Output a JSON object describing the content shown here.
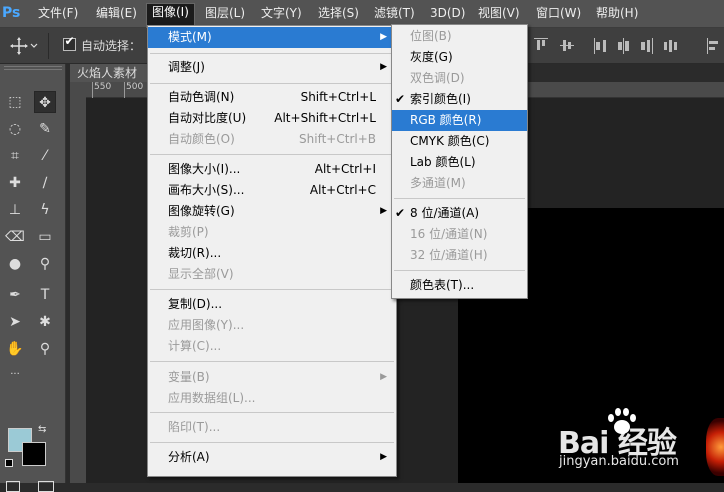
{
  "app": {
    "logo": "Ps"
  },
  "menubar": [
    {
      "label": "文件(F)"
    },
    {
      "label": "编辑(E)"
    },
    {
      "label": "图像(I)",
      "active": true
    },
    {
      "label": "图层(L)"
    },
    {
      "label": "文字(Y)"
    },
    {
      "label": "选择(S)"
    },
    {
      "label": "滤镜(T)"
    },
    {
      "label": "3D(D)"
    },
    {
      "label": "视图(V)"
    },
    {
      "label": "窗口(W)"
    },
    {
      "label": "帮助(H)"
    }
  ],
  "options": {
    "auto_select_label": "自动选择：",
    "auto_select_checked": true,
    "move_tool_icon": "move-icon"
  },
  "document": {
    "tab_title": "火焰人素材",
    "ruler_ticks": [
      "550",
      "500"
    ]
  },
  "image_menu": {
    "items": [
      {
        "label": "模式(M)",
        "shortcut": "",
        "submenu": true,
        "disabled": false,
        "highlighted": true
      },
      {
        "label": "调整(J)",
        "shortcut": "",
        "submenu": true,
        "disabled": false
      },
      {
        "label": "自动色调(N)",
        "shortcut": "Shift+Ctrl+L",
        "disabled": false
      },
      {
        "label": "自动对比度(U)",
        "shortcut": "Alt+Shift+Ctrl+L",
        "disabled": false
      },
      {
        "label": "自动颜色(O)",
        "shortcut": "Shift+Ctrl+B",
        "disabled": true
      },
      {
        "label": "图像大小(I)...",
        "shortcut": "Alt+Ctrl+I",
        "disabled": false
      },
      {
        "label": "画布大小(S)...",
        "shortcut": "Alt+Ctrl+C",
        "disabled": false
      },
      {
        "label": "图像旋转(G)",
        "shortcut": "",
        "submenu": true,
        "disabled": false
      },
      {
        "label": "裁剪(P)",
        "shortcut": "",
        "disabled": true
      },
      {
        "label": "裁切(R)...",
        "shortcut": "",
        "disabled": false
      },
      {
        "label": "显示全部(V)",
        "shortcut": "",
        "disabled": true
      },
      {
        "label": "复制(D)...",
        "shortcut": "",
        "disabled": false
      },
      {
        "label": "应用图像(Y)...",
        "shortcut": "",
        "disabled": true
      },
      {
        "label": "计算(C)...",
        "shortcut": "",
        "disabled": true
      },
      {
        "label": "变量(B)",
        "shortcut": "",
        "submenu": true,
        "disabled": true
      },
      {
        "label": "应用数据组(L)...",
        "shortcut": "",
        "disabled": true
      },
      {
        "label": "陷印(T)...",
        "shortcut": "",
        "disabled": true
      },
      {
        "label": "分析(A)",
        "shortcut": "",
        "submenu": true,
        "disabled": false
      }
    ]
  },
  "mode_submenu": {
    "items": [
      {
        "label": "位图(B)",
        "disabled": true,
        "checked": false
      },
      {
        "label": "灰度(G)",
        "disabled": false,
        "checked": false
      },
      {
        "label": "双色调(D)",
        "disabled": true,
        "checked": false
      },
      {
        "label": "索引颜色(I)",
        "disabled": false,
        "checked": true
      },
      {
        "label": "RGB 颜色(R)",
        "disabled": false,
        "checked": false,
        "highlighted": true
      },
      {
        "label": "CMYK 颜色(C)",
        "disabled": false,
        "checked": false
      },
      {
        "label": "Lab 颜色(L)",
        "disabled": false,
        "checked": false
      },
      {
        "label": "多通道(M)",
        "disabled": true,
        "checked": false
      },
      {
        "label": "8 位/通道(A)",
        "disabled": false,
        "checked": true
      },
      {
        "label": "16 位/通道(N)",
        "disabled": true,
        "checked": false
      },
      {
        "label": "32 位/通道(H)",
        "disabled": true,
        "checked": false
      },
      {
        "label": "颜色表(T)...",
        "disabled": false,
        "checked": false
      }
    ],
    "check_glyph": "✔"
  },
  "tools": {
    "foreground_color": "#9bcad6",
    "background_color": "#000000"
  },
  "watermark": {
    "logo": "Bai  经验",
    "url": "jingyan.baidu.com"
  },
  "glyphs": {
    "submenu_arrow": "▶"
  }
}
